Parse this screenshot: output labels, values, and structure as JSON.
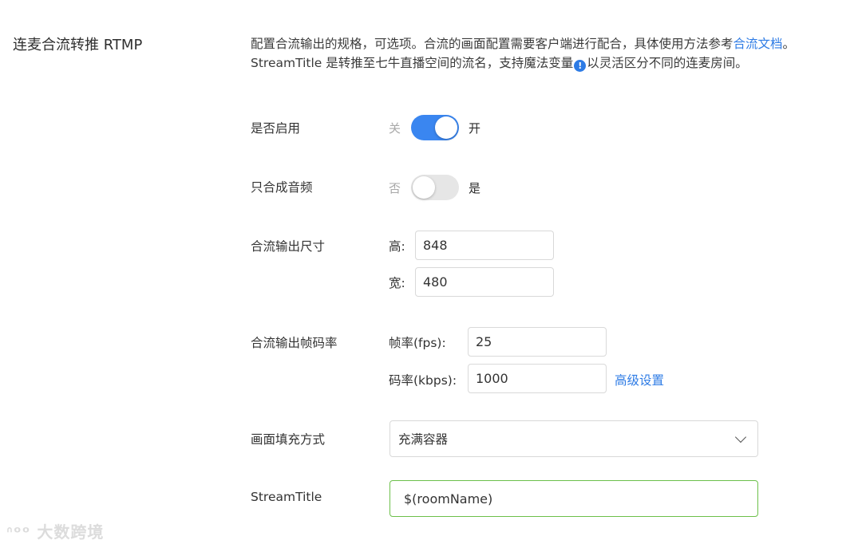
{
  "section": {
    "title": "连麦合流转推 RTMP"
  },
  "description": {
    "line1_text": "配置合流输出的规格，可选项。合流的画面配置需要客户端进行配合，具体使用方法参考",
    "line1_link": "合流文档",
    "line1_end": "。",
    "line2_before": "StreamTitle 是转推至七牛直播空间的流名，支持魔法变量",
    "info_icon": "!",
    "line2_after": "以灵活区分不同的连麦房间。"
  },
  "enable": {
    "label": "是否启用",
    "off_text": "关",
    "on_text": "开",
    "value": true
  },
  "audio_only": {
    "label": "只合成音频",
    "off_text": "否",
    "on_text": "是",
    "value": false
  },
  "output_size": {
    "label": "合流输出尺寸",
    "height_label": "高:",
    "height_value": "848",
    "width_label": "宽:",
    "width_value": "480"
  },
  "output_rate": {
    "label": "合流输出帧码率",
    "fps_label": "帧率(fps):",
    "fps_value": "25",
    "kbps_label": "码率(kbps):",
    "kbps_value": "1000",
    "advanced_link": "高级设置"
  },
  "fill_mode": {
    "label": "画面填充方式",
    "selected": "充满容器"
  },
  "stream_title": {
    "label": "StreamTitle",
    "value": "$(roomName)"
  },
  "watermark": {
    "text": "大数跨境"
  },
  "colors": {
    "accent": "#2d7be5",
    "switch_on": "#3a86f0",
    "focus_border": "#6cc04a"
  }
}
